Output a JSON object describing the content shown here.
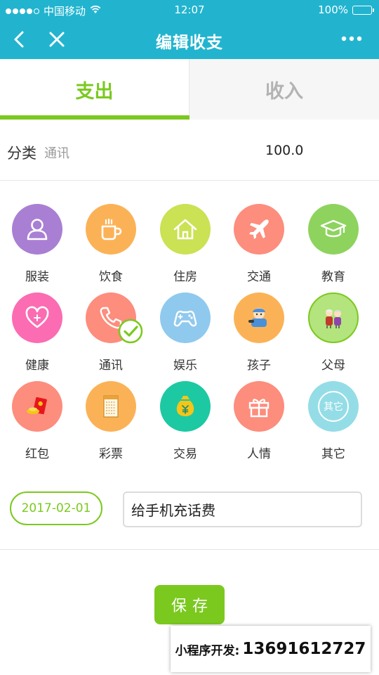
{
  "status_bar": {
    "carrier": "中国移动",
    "time": "12:07",
    "battery": "100%"
  },
  "nav": {
    "title": "编辑收支"
  },
  "tabs": [
    {
      "label": "支出",
      "active": true
    },
    {
      "label": "收入",
      "active": false
    }
  ],
  "form": {
    "category_label": "分类",
    "category_value": "通讯",
    "amount": "100.0"
  },
  "categories": [
    {
      "label": "服装",
      "icon": "clothing-icon",
      "color": "#a97fd4"
    },
    {
      "label": "饮食",
      "icon": "food-icon",
      "color": "#fbb257"
    },
    {
      "label": "住房",
      "icon": "house-icon",
      "color": "#cae253"
    },
    {
      "label": "交通",
      "icon": "airplane-icon",
      "color": "#fd8d7d"
    },
    {
      "label": "教育",
      "icon": "graduation-cap-icon",
      "color": "#8ed35e"
    },
    {
      "label": "健康",
      "icon": "heart-icon",
      "color": "#fb6cb2"
    },
    {
      "label": "通讯",
      "icon": "phone-icon",
      "color": "#fd8d7d",
      "selected": true
    },
    {
      "label": "娱乐",
      "icon": "gamepad-icon",
      "color": "#8fc9ee"
    },
    {
      "label": "孩子",
      "icon": "child-icon",
      "color": "#fbb257"
    },
    {
      "label": "父母",
      "icon": "parents-icon",
      "color": "#b3e47d"
    },
    {
      "label": "红包",
      "icon": "red-envelope-icon",
      "color": "#fd8d7d"
    },
    {
      "label": "彩票",
      "icon": "lottery-ticket-icon",
      "color": "#fbb257"
    },
    {
      "label": "交易",
      "icon": "money-bag-icon",
      "color": "#1cc9a2"
    },
    {
      "label": "人情",
      "icon": "gift-icon",
      "color": "#fd8d7d"
    },
    {
      "label": "其它",
      "icon": "other-icon",
      "color": "#94dde6",
      "text": "其它"
    }
  ],
  "date": "2017-02-01",
  "note": {
    "value": "给手机充话费",
    "placeholder": ""
  },
  "save_label": "保存",
  "dev_banner": {
    "label": "小程序开发:",
    "number": "13691612727"
  },
  "colors": {
    "primary": "#22b4cf",
    "accent": "#7bc91f"
  }
}
